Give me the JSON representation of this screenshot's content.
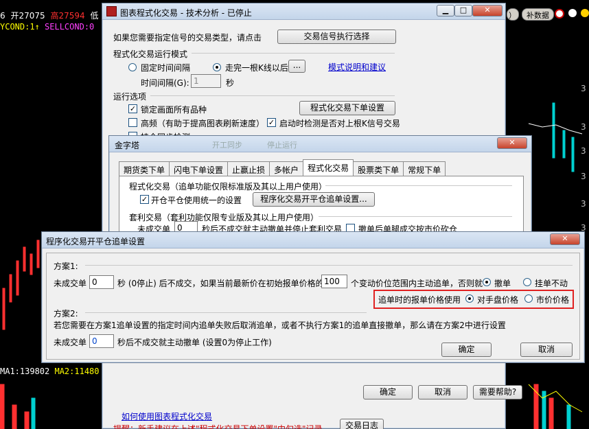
{
  "background": {
    "ticker": {
      "open": "开27075",
      "high": "高27594",
      "low": "低"
    },
    "cond": {
      "ycond": "YCOND:1↑",
      "sellcond": "SELLCOND:0"
    },
    "ma": {
      "ma1": "MA1:139802",
      "ma2": "MA2:11480"
    },
    "top_buttons": {
      "left": "）",
      "right": "补数据"
    },
    "left_edge": "6",
    "right_axis": [
      "3",
      "3",
      "3",
      "3",
      "3",
      "3"
    ]
  },
  "main_window": {
    "title": "图表程式化交易 - 技术分析 - 已停止",
    "signal_prompt": "如果您需要指定信号的交易类型，请点击",
    "signal_button": "交易信号执行选择",
    "run_mode_label": "程式化交易运行模式",
    "mode_fixed": "固定时间间隔",
    "mode_bar": "走完一根K线以后",
    "dots_button": "...",
    "mode_link": "模式说明和建议",
    "interval_label": "时间间隔(G):",
    "interval_value": "1",
    "interval_unit": "秒",
    "options_label": "运行选项",
    "opt_lock": "锁定画面所有品种",
    "order_settings_button": "程式化交易下单设置",
    "opt_highfreq": "高频（有助于提高图表刷新速度）",
    "opt_check_signal": "启动时检测是否对上根K信号交易",
    "opt_sync_partial": "持仓同步检测",
    "bottom_ok": "确定",
    "bottom_cancel": "取消",
    "bottom_help": "需要帮助?",
    "howto_link": "如何使用图表程式化交易",
    "tip": "提醒：新手建议在上述\"程式化交易下单设置\"中勾选\"记录",
    "log_button": "交易日志"
  },
  "pyramid_window": {
    "title": "金字塔",
    "tabs": [
      "期货类下单",
      "闪电下单设置",
      "止赢止损",
      "多帐户",
      "程式化交易",
      "股票类下单",
      "常规下单"
    ],
    "active_tab": 4,
    "group1": "程式化交易（追单功能仅限标准版及其以上用户使用）",
    "unified_open_close": "开仓平仓使用统一的设置",
    "chase_button": "程序化交易开平仓追单设置...",
    "group2": "套利交易（套利功能仅限专业版及其以上用户使用）",
    "arb_text": "未成交单",
    "arb_value": "0",
    "arb_tail": "秒后不成交就主动撤单并停止套利交易",
    "arb_chk": "撤单后单腿成交按市价砍仓",
    "hidden_buttons": [
      "开工同步",
      "停止运行"
    ]
  },
  "chase_dialog": {
    "title": "程序化交易开平仓追单设置",
    "plan1_label": "方案1:",
    "plan1_prefix": "未成交单",
    "plan1_seconds": "0",
    "plan1_mid": "秒 (0停止) 后不成交，如果当前最新价在初始报单价格的",
    "plan1_ticks": "100",
    "plan1_tail": "个变动价位范围内主动追单，否则就",
    "opt_cancel": "撤单",
    "opt_hang": "挂单不动",
    "price_label": "追单时的报单价格使用",
    "opt_counter": "对手盘价格",
    "opt_market": "市价价格",
    "plan2_label": "方案2:",
    "plan2_desc": "若您需要在方案1追单设置的指定时间内追单失败后取消追单，或者不执行方案1的追单直接撤单，那么请在方案2中进行设置",
    "plan2_prefix": "未成交单",
    "plan2_seconds": "0",
    "plan2_tail": "秒后不成交就主动撤单 (设置0为停止工作)",
    "ok": "确定",
    "cancel": "取消"
  },
  "colors": {
    "red": "#e02020",
    "green": "#00d0d0",
    "yellow": "#ffff00",
    "magenta": "#ff40ff"
  }
}
